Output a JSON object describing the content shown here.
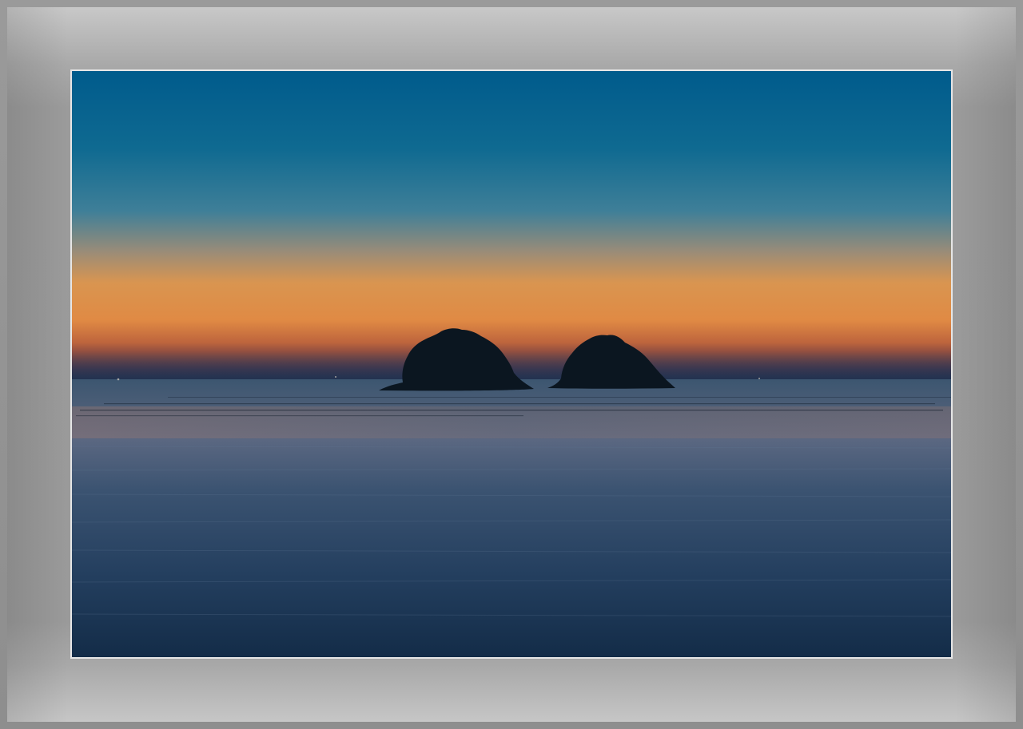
{
  "scene": {
    "subject": "twin-islands-at-dusk",
    "colors": {
      "sky_top": "#005a8c",
      "sky_mid": "#3b7a9a",
      "sky_glow": "#d98c4a",
      "horizon_band": "#3c3a54",
      "sea": "#2c4560",
      "sea_deep": "#142a44",
      "island": "#0b1620",
      "frame": "#9a9a9a",
      "border": "#e6e6e6"
    }
  }
}
